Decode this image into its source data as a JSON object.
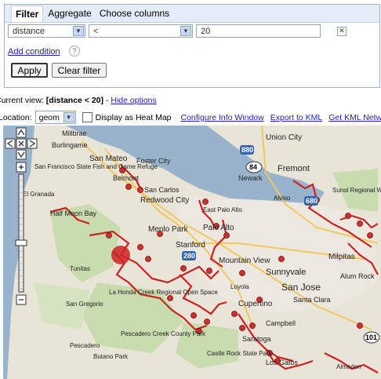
{
  "tabs": [
    {
      "label": "Filter"
    },
    {
      "label": "Aggregate"
    },
    {
      "label": "Choose columns"
    }
  ],
  "filter": {
    "column": "distance",
    "operator": "<",
    "value": "20",
    "add_condition": "Add condition",
    "help": "?",
    "apply": "Apply",
    "clear": "Clear filter"
  },
  "view": {
    "prefix": "Current view:",
    "current": "[distance < 20]",
    "hide": "Hide options"
  },
  "location": {
    "label": "Location:",
    "value": "geom",
    "heatmap": "Display as Heat Map",
    "configure": "Configure Info Window",
    "export": "Export to KML",
    "network": "Get KML Netw"
  },
  "map": {
    "places": [
      "Millbrae",
      "Burlingame",
      "San Mateo",
      "Foster City",
      "Union City",
      "Fremont",
      "Newark",
      "San Francisco State Fish and Game Refuge",
      "Belmont",
      "San Carlos",
      "Redwood City",
      "East Palo Alto",
      "Palo Alto",
      "Menlo Park",
      "Stanford",
      "Half Moon Bay",
      "El Granada",
      "Mountain View",
      "Sunnyvale",
      "Milpitas",
      "San Jose",
      "Alum Rock",
      "Tunitas",
      "La Honda Creek Regional Open Space",
      "Cupertino",
      "Santa Clara",
      "Campbell",
      "Saratoga",
      "Los Gatos",
      "San Gregorio",
      "Pescadero Creek County Park",
      "Pescadero",
      "Castle Rock State Park",
      "Butano Park",
      "Almaden",
      "Loyola",
      "Sunol Regional Wilderness",
      "Alviso"
    ],
    "highways": [
      "880",
      "84",
      "101",
      "280",
      "680"
    ]
  },
  "colors": {
    "accent": "#3366cc",
    "route": "#cc2222",
    "tab_bg": "#e5ecf9"
  }
}
